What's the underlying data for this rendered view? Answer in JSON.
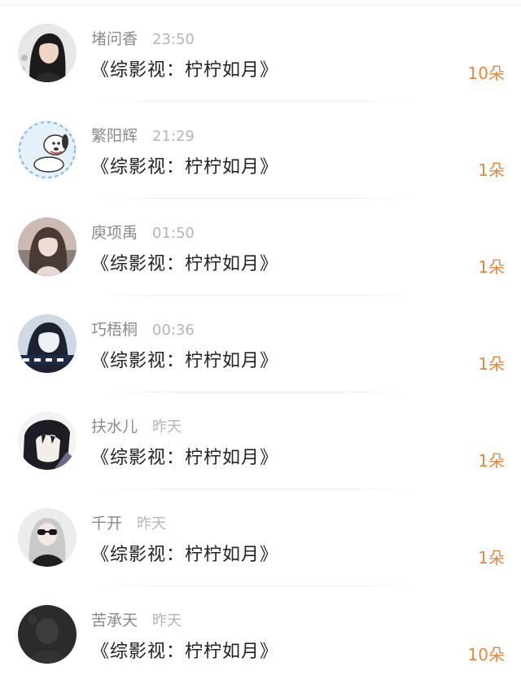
{
  "messages": [
    {
      "name": "堵问香",
      "time": "23:50",
      "title": "《综影视：柠柠如月》",
      "flowers": "10朵",
      "avatar_icon": "woman-portrait-avatar"
    },
    {
      "name": "繁阳辉",
      "time": "21:29",
      "title": "《综影视：柠柠如月》",
      "flowers": "1朵",
      "avatar_icon": "cartoon-dog-avatar"
    },
    {
      "name": "庾项禹",
      "time": "01:50",
      "title": "《综影视：柠柠如月》",
      "flowers": "1朵",
      "avatar_icon": "girl-photo-avatar"
    },
    {
      "name": "巧梧桐",
      "time": "00:36",
      "title": "《综影视：柠柠如月》",
      "flowers": "1朵",
      "avatar_icon": "boy-photo-avatar"
    },
    {
      "name": "扶水儿",
      "time": "昨天",
      "title": "《综影视：柠柠如月》",
      "flowers": "1朵",
      "avatar_icon": "anime-boy-avatar"
    },
    {
      "name": "千开",
      "time": "昨天",
      "title": "《综影视：柠柠如月》",
      "flowers": "1朵",
      "avatar_icon": "sunglasses-girl-avatar"
    },
    {
      "name": "苦承天",
      "time": "昨天",
      "title": "《综影视：柠柠如月》",
      "flowers": "10朵",
      "avatar_icon": "dark-figure-avatar"
    }
  ],
  "colors": {
    "accent": "#e8873a",
    "name_text": "#8a8a8a",
    "time_text": "#b5b5b5",
    "title_text": "#222222"
  }
}
